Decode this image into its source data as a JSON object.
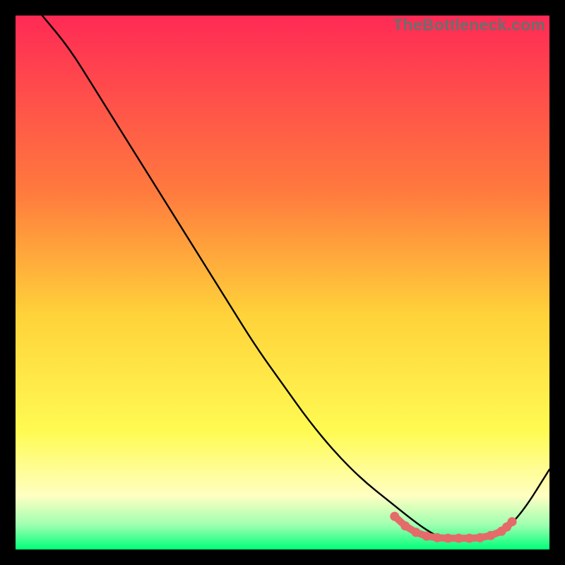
{
  "watermark": "TheBottleneck.com",
  "colors": {
    "top": "#ff2a55",
    "mid_upper": "#ff7a3e",
    "mid": "#ffd23a",
    "mid_lower": "#fffb53",
    "pale_yellow": "#ffffc2",
    "green_light": "#9cffb0",
    "green": "#00ff79",
    "curve": "#000000",
    "dots": "#e56a6a",
    "bg": "#000000"
  },
  "chart_data": {
    "type": "line",
    "title": "",
    "xlabel": "",
    "ylabel": "",
    "xlim": [
      0,
      100
    ],
    "ylim": [
      0,
      100
    ],
    "grid": false,
    "legend": false,
    "series": [
      {
        "name": "bottleneck-curve",
        "x": [
          5,
          10,
          15,
          20,
          25,
          30,
          35,
          40,
          45,
          50,
          55,
          60,
          65,
          70,
          75,
          78,
          80,
          83,
          85,
          88,
          91,
          95,
          100
        ],
        "y": [
          100,
          94,
          86,
          78,
          70,
          62,
          54,
          46,
          38,
          31,
          24,
          18,
          13,
          9,
          5,
          3,
          2,
          2,
          2,
          2,
          3,
          7,
          15
        ]
      }
    ],
    "highlight_region": {
      "name": "optimal-range-dots",
      "x": [
        71,
        73,
        75,
        77,
        79,
        81,
        83,
        85,
        87,
        89,
        91,
        92,
        93
      ],
      "y": [
        6.2,
        4.4,
        3.2,
        2.5,
        2.2,
        2.1,
        2.1,
        2.1,
        2.2,
        2.6,
        3.4,
        4.2,
        5.2
      ]
    },
    "gradient_stops": [
      {
        "offset": 0.0,
        "key": "top"
      },
      {
        "offset": 0.33,
        "key": "mid_upper"
      },
      {
        "offset": 0.56,
        "key": "mid"
      },
      {
        "offset": 0.78,
        "key": "mid_lower"
      },
      {
        "offset": 0.9,
        "key": "pale_yellow"
      },
      {
        "offset": 0.955,
        "key": "green_light"
      },
      {
        "offset": 1.0,
        "key": "green"
      }
    ]
  }
}
